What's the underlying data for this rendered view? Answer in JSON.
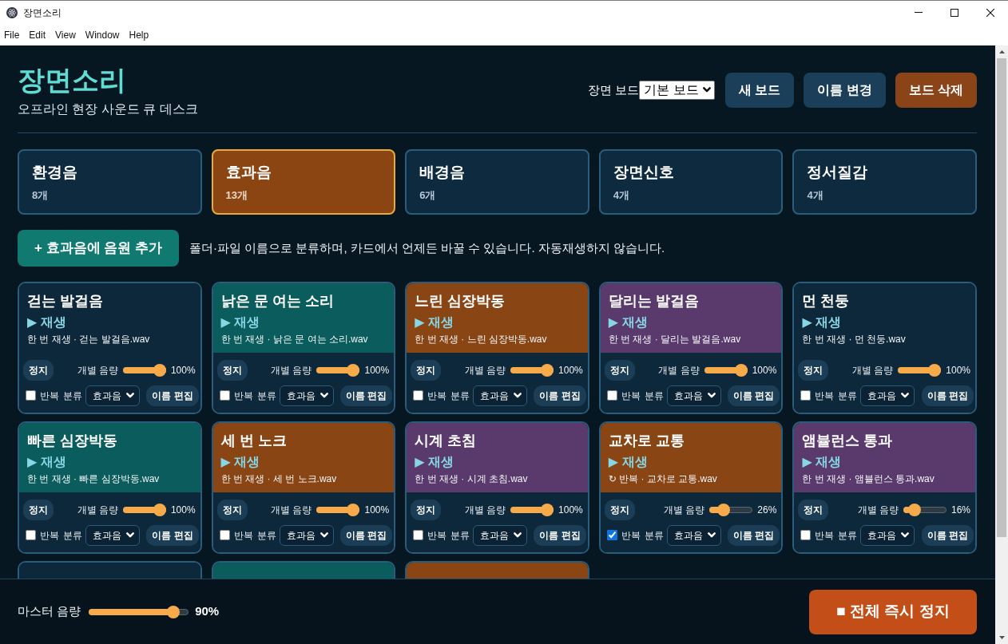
{
  "window": {
    "title": "장면소리",
    "menu": [
      "File",
      "Edit",
      "View",
      "Window",
      "Help"
    ]
  },
  "header": {
    "title": "장면소리",
    "subtitle": "오프라인 현장 사운드 큐 데스크",
    "board_label": "장면 보드",
    "board_select": "기본 보드",
    "buttons": [
      {
        "label": "새 보드",
        "kind": "normal"
      },
      {
        "label": "이름 변경",
        "kind": "normal"
      },
      {
        "label": "보드 삭제",
        "kind": "danger"
      }
    ]
  },
  "categories": [
    {
      "name": "환경음",
      "count": "8개",
      "selected": false
    },
    {
      "name": "효과음",
      "count": "13개",
      "selected": true
    },
    {
      "name": "배경음",
      "count": "6개",
      "selected": false
    },
    {
      "name": "장면신호",
      "count": "4개",
      "selected": false
    },
    {
      "name": "정서질감",
      "count": "4개",
      "selected": false
    }
  ],
  "add_button": {
    "label": "+ 효과음에 음원 추가"
  },
  "hint": "폴더·파일 이름으로 분류하며, 카드에서 언제든 바꿀 수 있습니다. 자동재생하지 않습니다.",
  "cards": [
    {
      "title": "걷는 발걸음",
      "color": "#0e283b",
      "play": "▶ 재생",
      "info": "한 번 재생 · 걷는 발걸음.wav",
      "stop": "정지",
      "volume_label": "개별 음량",
      "level": 1,
      "reading": "100%",
      "loop": false,
      "loop_label": "반복",
      "category_label": "분류",
      "category": "효과음",
      "edit": "이름 편집"
    },
    {
      "title": "낡은 문 여는 소리",
      "color": "#0b5c5d",
      "play": "▶ 재생",
      "info": "한 번 재생 · 낡은 문 여는 소리.wav",
      "stop": "정지",
      "volume_label": "개별 음량",
      "level": 1,
      "reading": "100%",
      "loop": false,
      "loop_label": "반복",
      "category_label": "분류",
      "category": "효과음",
      "edit": "이름 편집"
    },
    {
      "title": "느린 심장박동",
      "color": "#8a4514",
      "play": "▶ 재생",
      "info": "한 번 재생 · 느린 심장박동.wav",
      "stop": "정지",
      "volume_label": "개별 음량",
      "level": 1,
      "reading": "100%",
      "loop": false,
      "loop_label": "반복",
      "category_label": "분류",
      "category": "효과음",
      "edit": "이름 편집"
    },
    {
      "title": "달리는 발걸음",
      "color": "#5a3a6d",
      "play": "▶ 재생",
      "info": "한 번 재생 · 달리는 발걸음.wav",
      "stop": "정지",
      "volume_label": "개별 음량",
      "level": 1,
      "reading": "100%",
      "loop": false,
      "loop_label": "반복",
      "category_label": "분류",
      "category": "효과음",
      "edit": "이름 편집"
    },
    {
      "title": "먼 천둥",
      "color": "#0e283b",
      "play": "▶ 재생",
      "info": "한 번 재생 · 먼 천둥.wav",
      "stop": "정지",
      "volume_label": "개별 음량",
      "level": 1,
      "reading": "100%",
      "loop": false,
      "loop_label": "반복",
      "category_label": "분류",
      "category": "효과음",
      "edit": "이름 편집"
    },
    {
      "title": "빠른 심장박동",
      "color": "#0b5c5d",
      "play": "▶ 재생",
      "info": "한 번 재생 · 빠른 심장박동.wav",
      "stop": "정지",
      "volume_label": "개별 음량",
      "level": 1,
      "reading": "100%",
      "loop": false,
      "loop_label": "반복",
      "category_label": "분류",
      "category": "효과음",
      "edit": "이름 편집"
    },
    {
      "title": "세 번 노크",
      "color": "#8a4514",
      "play": "▶ 재생",
      "info": "한 번 재생 · 세 번 노크.wav",
      "stop": "정지",
      "volume_label": "개별 음량",
      "level": 1,
      "reading": "100%",
      "loop": false,
      "loop_label": "반복",
      "category_label": "분류",
      "category": "효과음",
      "edit": "이름 편집"
    },
    {
      "title": "시계 초침",
      "color": "#5a3a6d",
      "play": "▶ 재생",
      "info": "한 번 재생 · 시계 초침.wav",
      "stop": "정지",
      "volume_label": "개별 음량",
      "level": 1,
      "reading": "100%",
      "loop": false,
      "loop_label": "반복",
      "category_label": "분류",
      "category": "효과음",
      "edit": "이름 편집"
    },
    {
      "title": "교차로 교통",
      "color": "#8a4514",
      "play": "▶ 재생",
      "info": "↻ 반복 · 교차로 교통.wav",
      "stop": "정지",
      "volume_label": "개별 음량",
      "level": 0.26,
      "reading": "26%",
      "loop": true,
      "loop_label": "반복",
      "category_label": "분류",
      "category": "효과음",
      "edit": "이름 편집"
    },
    {
      "title": "앰뷸런스 통과",
      "color": "#5a3a6d",
      "play": "▶ 재생",
      "info": "한 번 재생 · 앰뷸런스 통과.wav",
      "stop": "정지",
      "volume_label": "개별 음량",
      "level": 0.16,
      "reading": "16%",
      "loop": false,
      "loop_label": "반복",
      "category_label": "분류",
      "category": "효과음",
      "edit": "이름 편집"
    },
    {
      "color": "#0e283b"
    },
    {
      "color": "#0b5c5d"
    },
    {
      "color": "#8a4514"
    }
  ],
  "master": {
    "label": "마스터 음량",
    "level": 0.9,
    "reading": "90%"
  },
  "stop_all": {
    "label": "■ 전체 즉시 정지"
  }
}
